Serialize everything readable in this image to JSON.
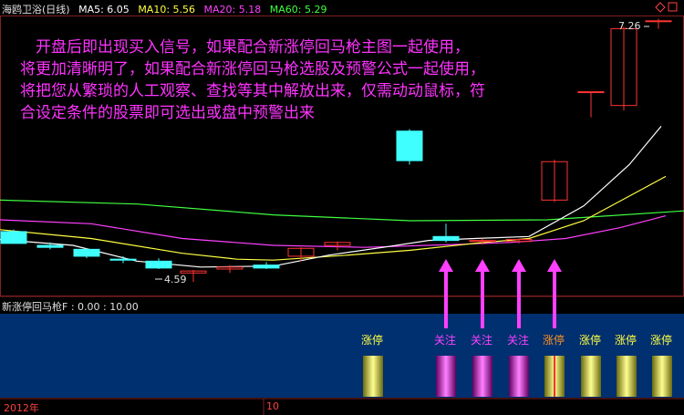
{
  "header": {
    "stock": "海鸥卫浴(日线)",
    "ma5": "MA5: 6.05",
    "ma10": "MA10: 5.56",
    "ma20": "MA20: 5.18",
    "ma60": "MA60: 5.29"
  },
  "note": [
    "　开盘后即出现买入信号，如果配合新涨停回马枪主图一起使用，",
    "将更加清晰明了，如果配合新涨停回马枪选股及预警公式一起使用，",
    "将把您从繁琐的人工观察、查找等其中解放出来，仅需动动鼠标，符",
    "合设定条件的股票即可选出或盘中预警出来"
  ],
  "price_high_label": "7.26",
  "price_low_label": "4.59",
  "indicator_title": "新涨停回马枪F  : 0.00 : 10.00",
  "timeline": {
    "year_label": "2012年",
    "month_label": "10"
  },
  "colors": {
    "up": "#ff3333",
    "down": "#40ffff",
    "ma5": "#ffffff",
    "ma10": "#ffff40",
    "ma20": "#ff40ff",
    "ma60": "#40ff40",
    "arrow": "#ff40ff",
    "panel_bg": "#003070",
    "limit_up": "#ffff40",
    "watch": "#ff40ff"
  },
  "chart_data": {
    "type": "candlestick",
    "candles": [
      {
        "o": 5.1,
        "h": 5.12,
        "l": 4.98,
        "c": 4.98
      },
      {
        "o": 4.96,
        "h": 4.99,
        "l": 4.92,
        "c": 4.94
      },
      {
        "o": 4.92,
        "h": 4.93,
        "l": 4.83,
        "c": 4.85
      },
      {
        "o": 4.82,
        "h": 4.85,
        "l": 4.78,
        "c": 4.81
      },
      {
        "o": 4.8,
        "h": 4.83,
        "l": 4.72,
        "c": 4.73
      },
      {
        "o": 4.68,
        "h": 4.71,
        "l": 4.59,
        "c": 4.7
      },
      {
        "o": 4.72,
        "h": 4.76,
        "l": 4.68,
        "c": 4.74
      },
      {
        "o": 4.76,
        "h": 4.79,
        "l": 4.72,
        "c": 4.73
      },
      {
        "o": 4.85,
        "h": 4.94,
        "l": 4.8,
        "c": 4.93
      },
      {
        "o": 4.96,
        "h": 5.0,
        "l": 4.91,
        "c": 4.99
      },
      {
        "o": 6.12,
        "h": 6.14,
        "l": 5.78,
        "c": 5.82
      },
      {
        "o": 5.05,
        "h": 5.18,
        "l": 4.99,
        "c": 5.01
      },
      {
        "o": 5.0,
        "h": 5.03,
        "l": 4.97,
        "c": 5.01
      },
      {
        "o": 5.0,
        "h": 5.03,
        "l": 4.98,
        "c": 5.02
      },
      {
        "o": 5.42,
        "h": 5.83,
        "l": 5.4,
        "c": 5.81
      },
      {
        "o": 6.52,
        "h": 6.52,
        "l": 6.26,
        "c": 6.52
      },
      {
        "o": 6.38,
        "h": 7.18,
        "l": 6.33,
        "c": 7.16
      },
      {
        "o": 7.24,
        "h": 7.26,
        "l": 7.16,
        "c": 7.24
      }
    ],
    "signals": [
      {
        "index": 11,
        "label": "涨停",
        "kind": "limit_up"
      },
      {
        "index": 12,
        "label": "关注",
        "kind": "watch"
      },
      {
        "index": 13,
        "label": "关注",
        "kind": "watch"
      },
      {
        "index": 14,
        "label": "关注",
        "kind": "watch"
      },
      {
        "index": 15,
        "label": "涨停",
        "kind": "limit_up"
      },
      {
        "index": 16,
        "label": "涨停",
        "kind": "limit_up"
      },
      {
        "index": 17,
        "label": "涨停",
        "kind": "limit_up"
      },
      {
        "index": 18,
        "label": "涨停",
        "kind": "limit_up"
      }
    ]
  }
}
